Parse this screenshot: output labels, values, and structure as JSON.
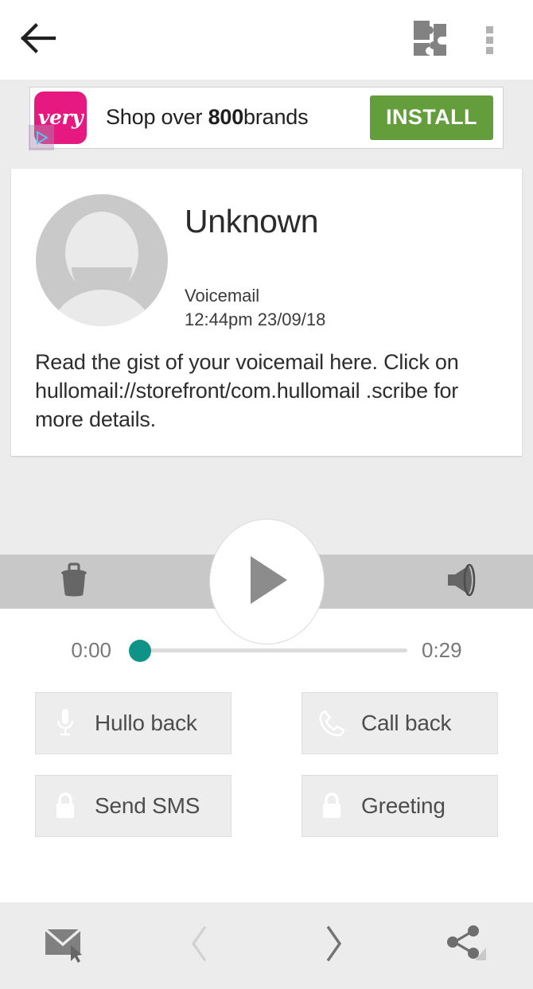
{
  "appbar": {
    "back_icon": "back-arrow-icon",
    "extension_icon": "puzzle-extension-icon",
    "overflow_icon": "overflow-menu-icon"
  },
  "ad": {
    "logo_text": "very",
    "headline_prefix": "Shop over ",
    "headline_bold": "800",
    "headline_suffix": "brands",
    "install_label": "INSTALL",
    "adchoices_icon": "adchoices-play-icon",
    "install_color": "#649d3c",
    "logo_color": "#e5197f"
  },
  "message": {
    "contact_name": "Unknown",
    "type_label": "Voicemail",
    "timestamp": "12:44pm 23/09/18",
    "transcript": "Read the gist of your voicemail here. Click on hullomail://storefront/com.hullomail .scribe for more details.",
    "avatar_icon": "person-avatar-icon"
  },
  "player": {
    "delete_icon": "trash-delete-icon",
    "play_icon": "play-icon",
    "speaker_icon": "speaker-volume-icon",
    "current_time": "0:00",
    "total_time": "0:29",
    "progress_percent": 0,
    "thumb_color": "#0f9387"
  },
  "actions": [
    {
      "label": "Hullo back",
      "icon": "microphone-icon",
      "locked": false
    },
    {
      "label": "Call back",
      "icon": "phone-handset-icon",
      "locked": false
    },
    {
      "label": "Send SMS",
      "icon": "lock-icon",
      "locked": true
    },
    {
      "label": "Greeting",
      "icon": "lock-icon",
      "locked": true
    }
  ],
  "bottom_nav": [
    {
      "name": "mailbox-button",
      "icon": "envelope-cursor-icon"
    },
    {
      "name": "previous-button",
      "icon": "chevron-left-icon"
    },
    {
      "name": "next-button",
      "icon": "chevron-right-icon"
    },
    {
      "name": "share-button",
      "icon": "share-icon"
    }
  ]
}
